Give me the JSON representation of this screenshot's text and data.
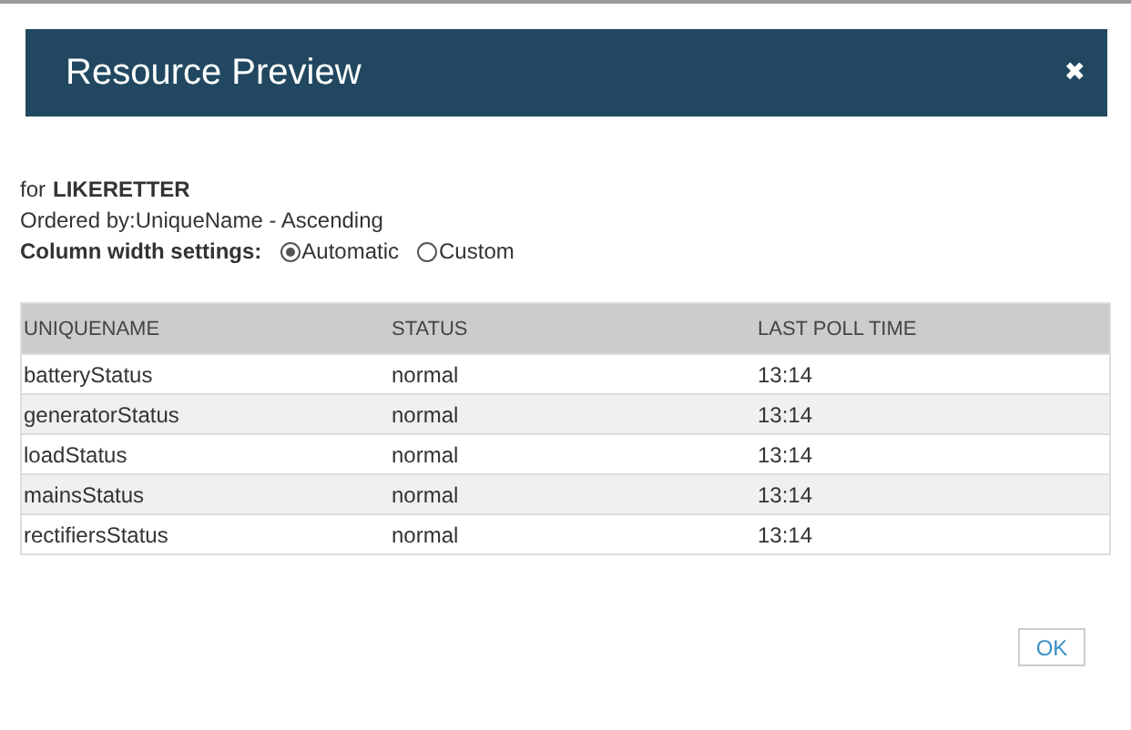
{
  "dialog": {
    "title": "Resource Preview",
    "close": "✖"
  },
  "info": {
    "for_label": "for",
    "resource": "LIKERETTER",
    "ordered_by": "Ordered by:UniqueName - Ascending",
    "width_label": "Column width settings:"
  },
  "width_options": [
    {
      "label": "Automatic",
      "selected": true
    },
    {
      "label": "Custom",
      "selected": false
    }
  ],
  "table": {
    "columns": [
      "UNIQUENAME",
      "STATUS",
      "LAST POLL TIME"
    ],
    "rows": [
      [
        "batteryStatus",
        "normal",
        "13:14"
      ],
      [
        "generatorStatus",
        "normal",
        "13:14"
      ],
      [
        "loadStatus",
        "normal",
        "13:14"
      ],
      [
        "mainsStatus",
        "normal",
        "13:14"
      ],
      [
        "rectifiersStatus",
        "normal",
        "13:14"
      ]
    ]
  },
  "buttons": [
    "OK"
  ]
}
